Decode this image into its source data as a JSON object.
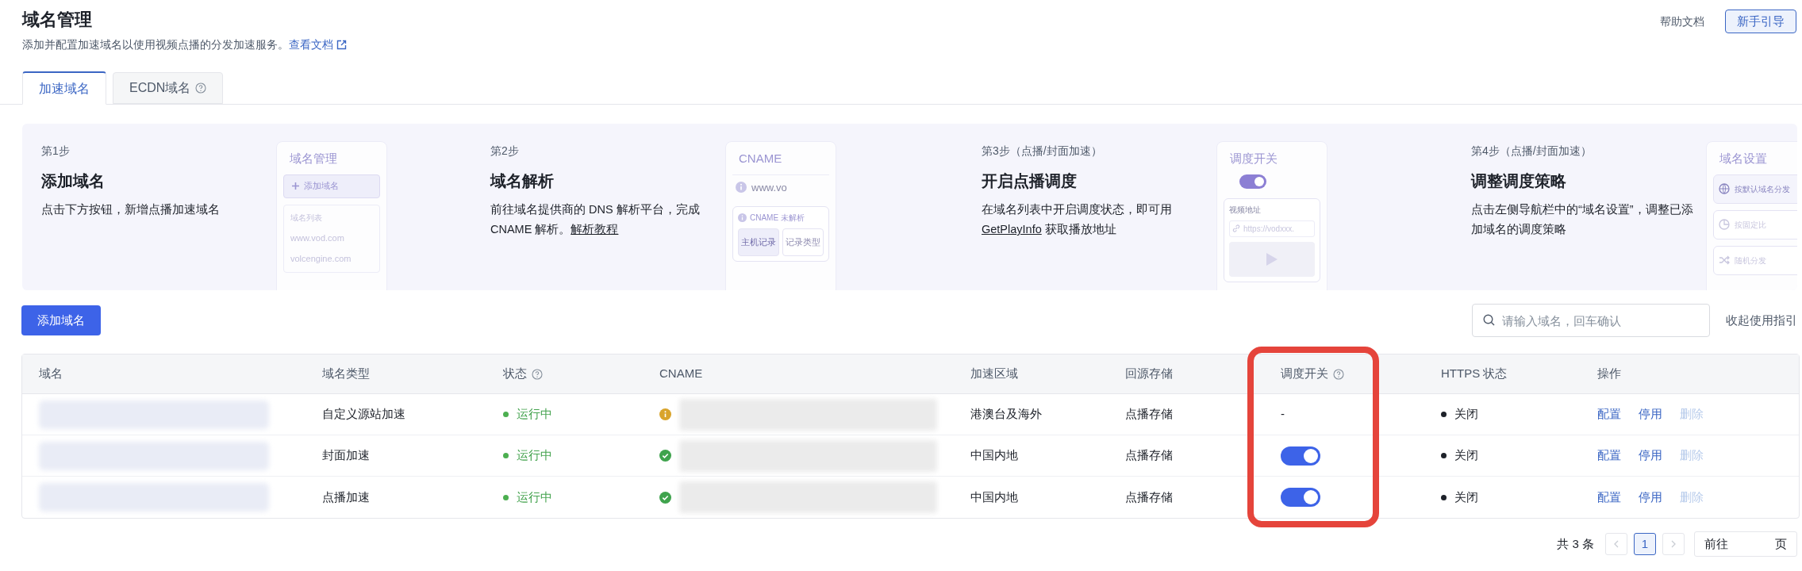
{
  "header": {
    "title": "域名管理",
    "subtitle": "添加并配置加速域名以使用视频点播的分发加速服务。",
    "doc_link": "查看文档",
    "help_link": "帮助文档",
    "guide_button": "新手引导"
  },
  "tabs": [
    {
      "label": "加速域名",
      "selected": true,
      "help": false
    },
    {
      "label": "ECDN域名",
      "selected": false,
      "help": true
    }
  ],
  "steps": [
    {
      "step": "第1步",
      "title": "添加域名",
      "desc": [
        {
          "text": "点击下方按钮，新增点播加速域名",
          "link": false
        }
      ],
      "illustration": {
        "kind": "domain-list",
        "title": "域名管理",
        "button": "添加域名",
        "list_title": "域名列表",
        "items": [
          "www.vod.com",
          "volcengine.com"
        ]
      }
    },
    {
      "step": "第2步",
      "title": "域名解析",
      "desc": [
        {
          "text": "前往域名提供商的 DNS 解析平台，完成 CNAME 解析。",
          "link": false
        },
        {
          "text": "解析教程",
          "link": true
        }
      ],
      "illustration": {
        "kind": "cname",
        "title": "CNAME",
        "row": "www.vo",
        "card_title": "CNAME 未解析",
        "fields": [
          "主机记录",
          "记录类型"
        ]
      }
    },
    {
      "step": "第3步（点播/封面加速）",
      "title": "开启点播调度",
      "desc": [
        {
          "text": "在域名列表中开启调度状态，即可用 ",
          "link": false
        },
        {
          "text": "GetPlayInfo",
          "link": true
        },
        {
          "text": " 获取播放地址",
          "link": false
        }
      ],
      "illustration": {
        "kind": "toggle",
        "title": "调度开关",
        "on": true,
        "card_title": "视频地址",
        "url": "https://vodxxx."
      }
    },
    {
      "step": "第4步（点播/封面加速）",
      "title": "调整调度策略",
      "desc": [
        {
          "text": "点击左侧导航栏中的“域名设置”，调整已添加域名的调度策略",
          "link": false
        }
      ],
      "illustration": {
        "kind": "settings",
        "title": "域名设置",
        "options": [
          {
            "kind": "globe",
            "label": "按默认域名分发"
          },
          {
            "kind": "pie",
            "label": "按固定比"
          },
          {
            "kind": "shuffle",
            "label": "随机分发"
          }
        ]
      }
    }
  ],
  "toolbar": {
    "add_button": "添加域名",
    "search_placeholder": "请输入域名，回车确认",
    "collapse_link": "收起使用指引"
  },
  "table": {
    "columns": [
      {
        "label": "域名",
        "help": false,
        "highlighted": false
      },
      {
        "label": "域名类型",
        "help": false,
        "highlighted": false
      },
      {
        "label": "状态",
        "help": true,
        "highlighted": false
      },
      {
        "label": "CNAME",
        "help": false,
        "highlighted": false
      },
      {
        "label": "加速区域",
        "help": false,
        "highlighted": false
      },
      {
        "label": "回源存储",
        "help": false,
        "highlighted": false
      },
      {
        "label": "调度开关",
        "help": true,
        "highlighted": true
      },
      {
        "label": "HTTPS 状态",
        "help": false,
        "highlighted": false
      },
      {
        "label": "操作",
        "help": false,
        "highlighted": false
      }
    ],
    "rows": [
      {
        "domain_redacted": true,
        "type": "自定义源站加速",
        "status": "运行中",
        "cname": {
          "kind": "warning",
          "redacted": true
        },
        "region": "港澳台及海外",
        "storage": "点播存储",
        "schedule": {
          "kind": "none",
          "text": "-"
        },
        "https": "关闭",
        "actions": [
          {
            "label": "配置",
            "disabled": false
          },
          {
            "label": "停用",
            "disabled": false
          },
          {
            "label": "删除",
            "disabled": true
          }
        ]
      },
      {
        "domain_redacted": true,
        "type": "封面加速",
        "status": "运行中",
        "cname": {
          "kind": "ok",
          "redacted": true
        },
        "region": "中国内地",
        "storage": "点播存储",
        "schedule": {
          "kind": "toggle",
          "on": true
        },
        "https": "关闭",
        "actions": [
          {
            "label": "配置",
            "disabled": false
          },
          {
            "label": "停用",
            "disabled": false
          },
          {
            "label": "删除",
            "disabled": true
          }
        ]
      },
      {
        "domain_redacted": true,
        "type": "点播加速",
        "status": "运行中",
        "cname": {
          "kind": "ok",
          "redacted": true
        },
        "region": "中国内地",
        "storage": "点播存储",
        "schedule": {
          "kind": "toggle",
          "on": true
        },
        "https": "关闭",
        "actions": [
          {
            "label": "配置",
            "disabled": false
          },
          {
            "label": "停用",
            "disabled": false
          },
          {
            "label": "删除",
            "disabled": true
          }
        ]
      }
    ]
  },
  "pagination": {
    "total": "共 3 条",
    "pages": [
      {
        "label": "1",
        "selected": true
      }
    ],
    "goto": "前往",
    "unit": "页"
  }
}
